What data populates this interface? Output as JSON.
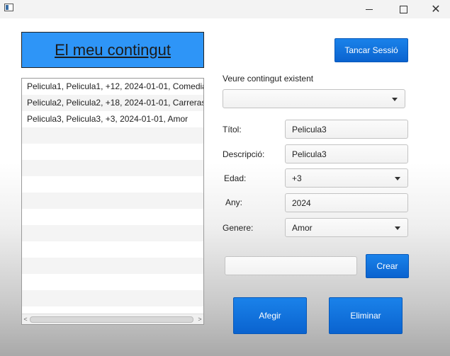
{
  "window": {
    "minimize_glyph": "",
    "maximize_glyph": "",
    "close_glyph": "✕"
  },
  "header": {
    "title": "El meu contingut"
  },
  "actions": {
    "logout_label": "Tancar Sessió"
  },
  "content_list": {
    "items": [
      "Pelicula1, Pelicula1, +12, 2024-01-01, Comedia",
      "Pelicula2, Pelicula2, +18, 2024-01-01, Carreras",
      "Pelicula3, Pelicula3, +3, 2024-01-01, Amor"
    ],
    "scroll_left_glyph": "<",
    "scroll_right_glyph": ">"
  },
  "existing": {
    "label": "Veure contingut existent",
    "selected": ""
  },
  "form": {
    "title_label": "Títol:",
    "title_value": "Pelicula3",
    "description_label": "Descripció:",
    "description_value": "Pelicula3",
    "age_label": "Edad:",
    "age_value": "+3",
    "year_label": "Any:",
    "year_value": "2024",
    "genre_label": "Genere:",
    "genre_value": "Amor"
  },
  "create": {
    "input_value": "",
    "button_label": "Crear"
  },
  "bottom_actions": {
    "add_label": "Afegir",
    "delete_label": "Eliminar"
  },
  "colors": {
    "accent": "#0a6fe0",
    "header_bg": "#2e95f7"
  }
}
